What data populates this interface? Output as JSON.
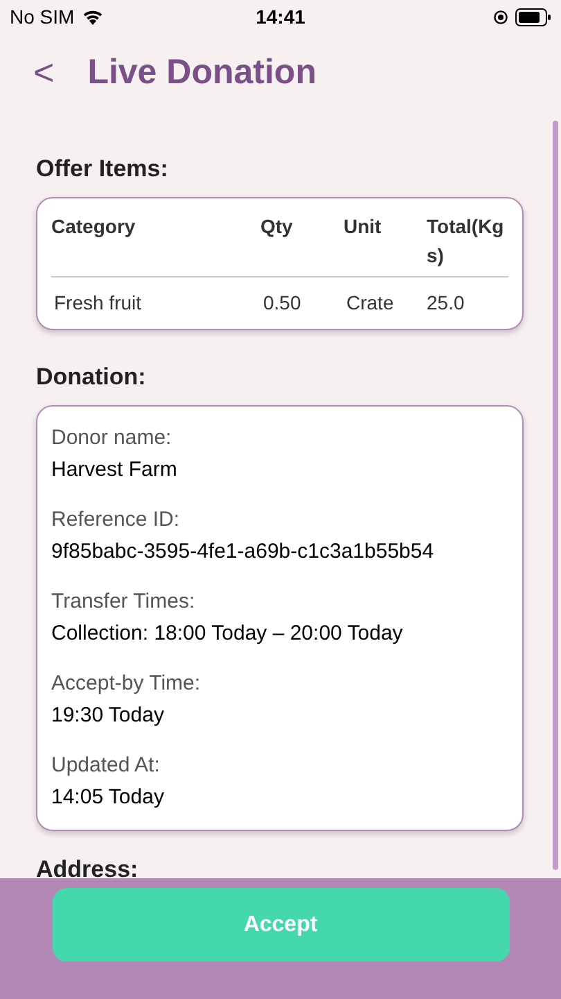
{
  "status_bar": {
    "carrier": "No SIM",
    "time": "14:41"
  },
  "header": {
    "back": "<",
    "title": "Live Donation"
  },
  "offer_items": {
    "heading": "Offer Items:",
    "columns": [
      "Category",
      "Qty",
      "Unit",
      "Total(Kgs)"
    ],
    "rows": [
      [
        "Fresh fruit",
        "0.50",
        "Crate",
        "25.0"
      ]
    ]
  },
  "donation": {
    "heading": "Donation:",
    "fields": [
      {
        "label": "Donor name:",
        "value": "Harvest Farm"
      },
      {
        "label": "Reference ID:",
        "value": "9f85babc-3595-4fe1-a69b-c1c3a1b55b54"
      },
      {
        "label": "Transfer Times:",
        "value": "Collection: 18:00 Today – 20:00 Today"
      },
      {
        "label": "Accept-by Time:",
        "value": "19:30 Today"
      },
      {
        "label": "Updated At:",
        "value": "14:05 Today"
      }
    ]
  },
  "address": {
    "heading": "Address:"
  },
  "accept_button": "Accept"
}
